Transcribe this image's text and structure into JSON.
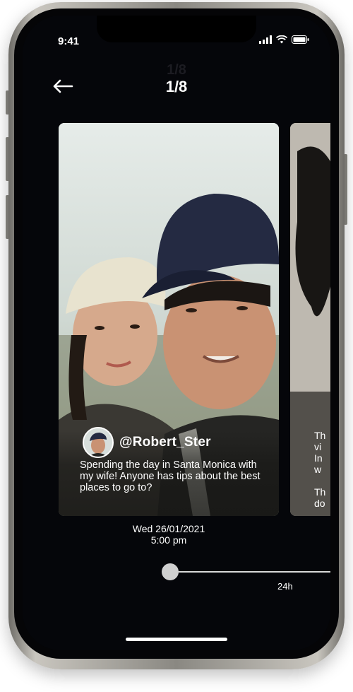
{
  "status_bar": {
    "time": "9:41",
    "icons": [
      "signal-icon",
      "wifi-icon",
      "battery-icon"
    ]
  },
  "header": {
    "back_icon": "arrow-left-icon",
    "counter": "1/8",
    "counter_ghost": "1/8"
  },
  "post": {
    "handle": "@Robert_Ster",
    "caption": "Spending the day in Santa Monica with my wife! Anyone has tips about the best places to go to?",
    "date": "Wed 26/01/2021",
    "time": "5:00 pm"
  },
  "next_post": {
    "caption_fragment": "Th\nvi\nIn\nw\n\nTh\ndo"
  },
  "timeline": {
    "label": "24h",
    "position": 0.0
  },
  "colors": {
    "background": "#05060a",
    "text": "#ffffff",
    "slider": "#d9d9d9"
  }
}
